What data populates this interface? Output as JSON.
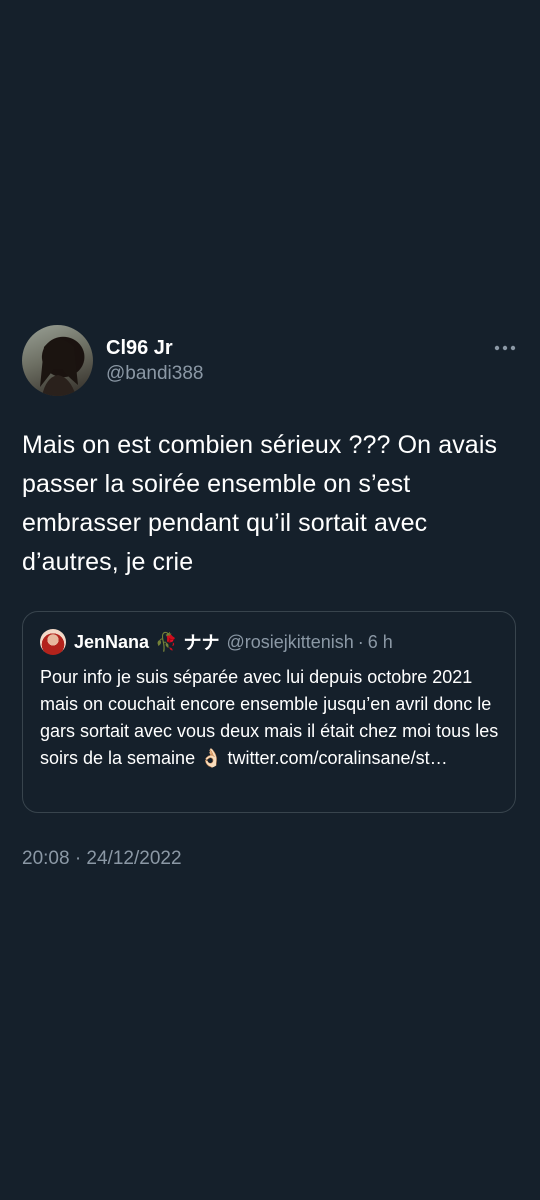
{
  "tweet": {
    "display_name": "Cl96 Jr",
    "handle": "@bandi388",
    "more_icon": "more-horizontal-icon",
    "text": "Mais on est combien sérieux ??? On avais passer la soirée ensemble on s’est embrasser pendant qu’il sortait avec d’autres, je crie",
    "timestamp": "20:08 · 24/12/2022"
  },
  "quote": {
    "display_name": "JenNana",
    "emoji": "🥀",
    "kana": "ナナ",
    "handle": "@rosiejkittenish",
    "dot": "·",
    "time": "6 h",
    "text": "Pour info je suis séparée avec lui depuis octobre 2021 mais on couchait encore ensemble jusqu’en avril donc le gars sortait avec vous deux mais il était chez moi tous les soirs de la semaine 👌🏻 twitter.com/coralinsane/st…"
  },
  "colors": {
    "background": "#15202b",
    "primary_text": "#ffffff",
    "secondary_text": "#8b98a5",
    "border": "#38444d"
  }
}
